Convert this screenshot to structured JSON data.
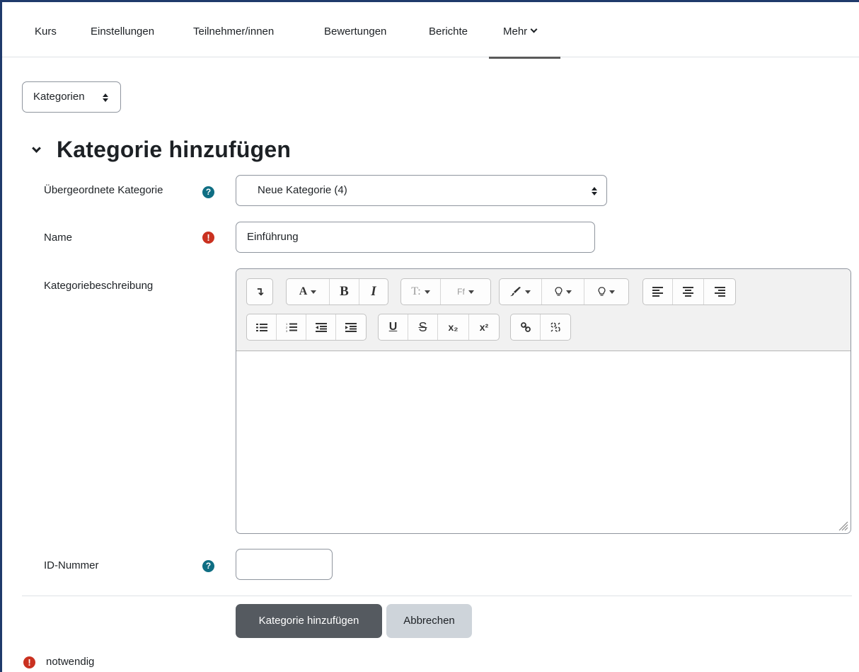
{
  "nav": {
    "items": [
      {
        "label": "Kurs"
      },
      {
        "label": "Einstellungen"
      },
      {
        "label": "Teilnehmer/innen"
      },
      {
        "label": "Bewertungen"
      },
      {
        "label": "Berichte"
      },
      {
        "label": "Mehr"
      }
    ]
  },
  "category_select": {
    "label": "Kategorien"
  },
  "section": {
    "title": "Kategorie hinzufügen"
  },
  "form": {
    "parent": {
      "label": "Übergeordnete Kategorie",
      "value": "Neue Kategorie (4)"
    },
    "name": {
      "label": "Name",
      "value": "Einführung"
    },
    "description": {
      "label": "Kategoriebeschreibung",
      "value": ""
    },
    "idnumber": {
      "label": "ID-Nummer",
      "value": ""
    }
  },
  "editor_toolbar": {
    "font_a": "A",
    "bold": "B",
    "italic": "I",
    "font_size": "T:",
    "font_family": "Ff",
    "underline": "U",
    "strike": "S",
    "subscript": "x₂",
    "superscript": "x²"
  },
  "buttons": {
    "submit": "Kategorie hinzufügen",
    "cancel": "Abbrechen"
  },
  "required_note": "notwendig",
  "colors": {
    "help": "#0f6e83",
    "required": "#ca3120",
    "primary_button": "#555a60",
    "secondary_button": "#ced4da"
  }
}
